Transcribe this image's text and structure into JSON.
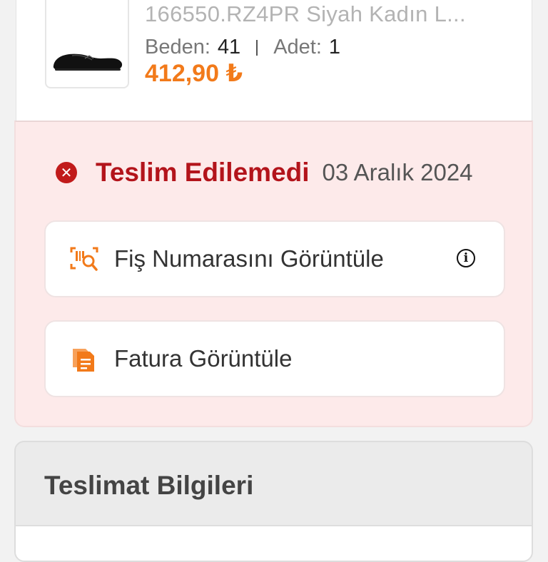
{
  "product": {
    "title": "166550.RZ4PR Siyah Kadın L...",
    "size_label": "Beden:",
    "size_value": "41",
    "qty_label": "Adet:",
    "qty_value": "1",
    "price": "412,90 ₺"
  },
  "status": {
    "icon": "x-circle-icon",
    "text": "Teslim Edilemedi",
    "date": "03 Aralık 2024",
    "color": "#b3141b"
  },
  "actions": {
    "receipt_label": "Fiş Numarasını Görüntüle",
    "invoice_label": "Fatura Görüntüle"
  },
  "delivery": {
    "title": "Teslimat Bilgileri"
  },
  "colors": {
    "accent": "#f27a1a",
    "status_bg": "#fdeaea"
  }
}
